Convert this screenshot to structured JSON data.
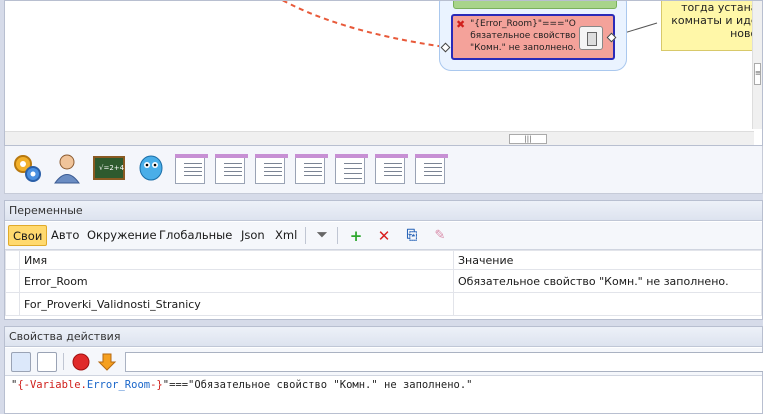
{
  "canvas": {
    "node_text": "\"{Error_Room}\"===\"О обязательное свойство \"Комн.\" не заполнено.",
    "node_line1": "\"{Error_Room}\"===\"О",
    "node_line2": "бязательное свойство",
    "node_line3": "\"Комн.\" не заполнено.",
    "note_text": "тогда устанав\nкомнаты и идет\nновое",
    "scroll_v_thumb": "≡",
    "scroll_h_thumb": "|||"
  },
  "icon_bar": {
    "icons": [
      "gears-icon",
      "user-icon",
      "chalkboard-icon",
      "robot-icon",
      "document-icon",
      "document-icon",
      "document-icon",
      "document-icon",
      "table-document-icon",
      "document-icon",
      "document-icon"
    ]
  },
  "variables": {
    "title": "Переменные",
    "tabs": [
      "Свои",
      "Авто",
      "Окружение",
      "Глобальные",
      "Json",
      "Xml"
    ],
    "active_tab": "Свои",
    "columns": [
      "Имя",
      "Значение"
    ],
    "rows": [
      {
        "name": "Error_Room",
        "value": "Обязательное свойство \"Комн.\" не заполнено."
      },
      {
        "name": "For_Proverki_Validnosti_Stranicy",
        "value": ""
      }
    ]
  },
  "action_props": {
    "title": "Свойства действия",
    "input_value": "",
    "expression_part1": "\"",
    "expression_var": "{-Variable.",
    "expression_var_name": "Error_Room",
    "expression_var_end": "-}",
    "expression_rest": "\"===\"Обязательное свойство \"Комн.\" не заполнено.\""
  },
  "colors": {
    "active_tab_bg": "#ffd96e",
    "node_bg": "#f4a29a",
    "node_border": "#2a2ab8",
    "connector": "#e85a3a",
    "note_bg": "#fff7a8"
  }
}
